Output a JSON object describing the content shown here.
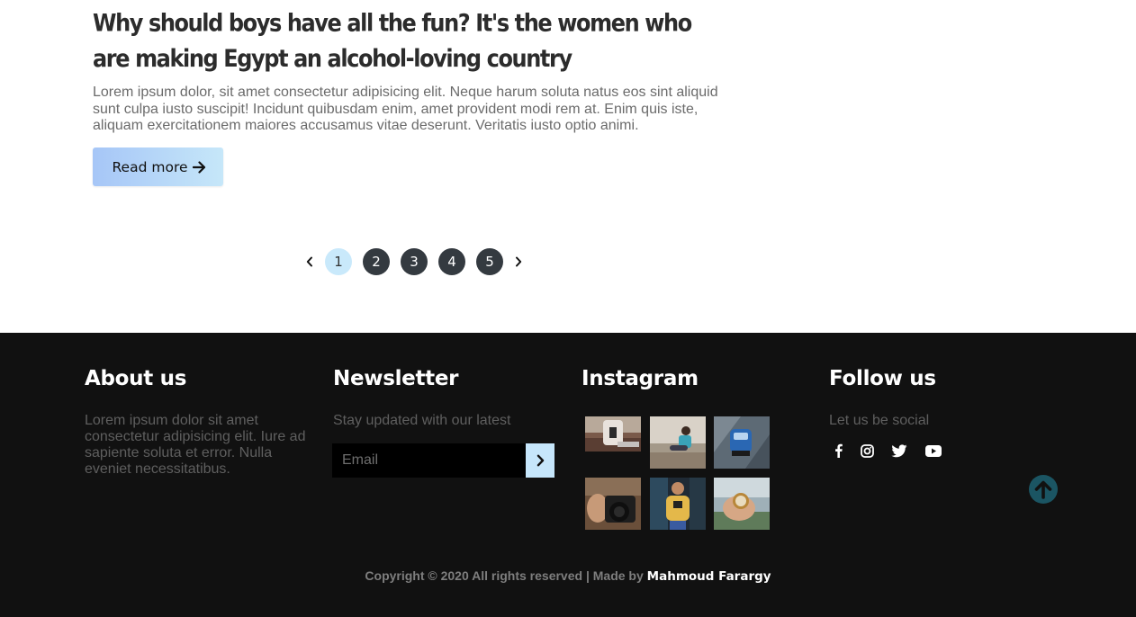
{
  "article": {
    "title": "Why should boys have all the fun? It's the women who are making Egypt an alcohol-loving country",
    "excerpt": "Lorem ipsum dolor, sit amet consectetur adipisicing elit. Neque harum soluta natus eos sint aliquid sunt culpa iusto suscipit! Incidunt quibusdam enim, amet provident modi rem at. Enim quis iste, aliquam exercitationem maiores accusamus vitae deserunt. Veritatis iusto optio animi.",
    "read_more_label": "Read more",
    "read_more_icon": "arrow-right-icon",
    "button_gradient": [
      "#a6c6f7",
      "#c6e7f9"
    ]
  },
  "pagination": {
    "pages": [
      "1",
      "2",
      "3",
      "4",
      "5"
    ],
    "active_page": "1",
    "prev_icon": "chevron-left-icon",
    "next_icon": "chevron-right-icon",
    "active_color": "#c9e9fb",
    "inactive_color": "#343a40"
  },
  "footer": {
    "background": "#111111",
    "about": {
      "heading": "About us",
      "text": "Lorem ipsum dolor sit amet consectetur adipisicing elit. Iure ad sapiente soluta et error. Nulla eveniet necessitatibus."
    },
    "newsletter": {
      "heading": "Newsletter",
      "text": "Stay updated with our latest",
      "email_placeholder": "Email",
      "email_value": "",
      "submit_icon": "chevron-right-icon"
    },
    "instagram": {
      "heading": "Instagram",
      "photos": [
        "instagram-photo-1",
        "instagram-photo-2",
        "instagram-photo-3",
        "instagram-photo-4",
        "instagram-photo-5",
        "instagram-photo-6"
      ]
    },
    "follow": {
      "heading": "Follow us",
      "text": "Let us be social",
      "icons": [
        "facebook-icon",
        "instagram-icon",
        "twitter-icon",
        "youtube-icon"
      ]
    },
    "back_to_top_icon": "arrow-circle-up-icon",
    "copyright": {
      "text": "Copyright © 2020 All rights reserved | Made by",
      "author": "Mahmoud Farargy"
    }
  }
}
